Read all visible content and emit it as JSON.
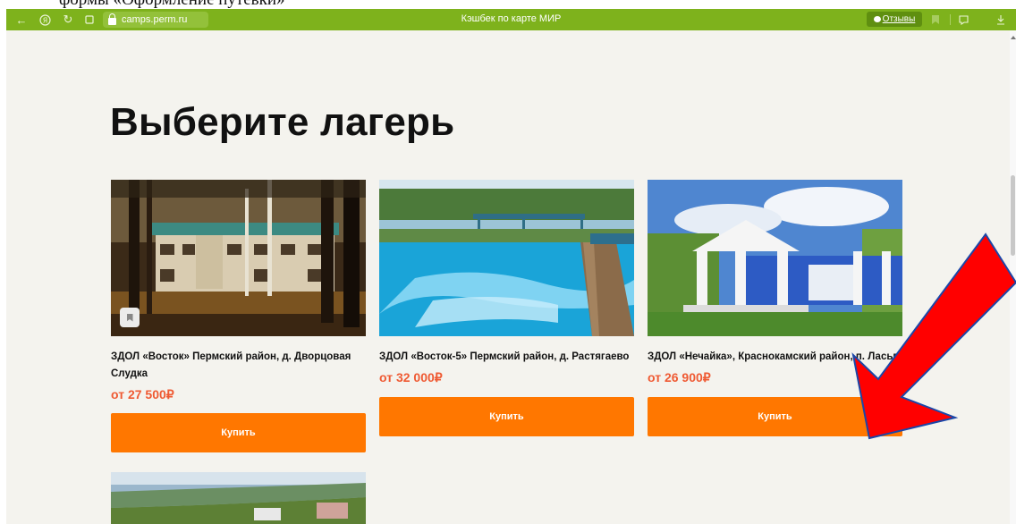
{
  "document": {
    "cut_text": "формы «Оформление путевки»"
  },
  "browser": {
    "url": "camps.perm.ru",
    "tab_title": "Кэшбек по карте МИР",
    "reviews_label": "Отзывы"
  },
  "page": {
    "heading": "Выберите лагерь",
    "camps": [
      {
        "title": "ЗДОЛ «Восток» Пермский район, д. Дворцовая Слудка",
        "price": "от 27 500₽",
        "button": "Купить"
      },
      {
        "title": "ЗДОЛ «Восток-5» Пермский район, д. Растягаево",
        "price": "от 32 000₽",
        "button": "Купить"
      },
      {
        "title": "ЗДОЛ «Нечайка», Краснокамский район, п. Ласьва",
        "price": "от 26 900₽",
        "button": "Купить"
      }
    ]
  },
  "colors": {
    "toolbar": "#7eb21c",
    "accent": "#ff7700",
    "price": "#ef5a33",
    "annotation_arrow": "#ff0000"
  }
}
